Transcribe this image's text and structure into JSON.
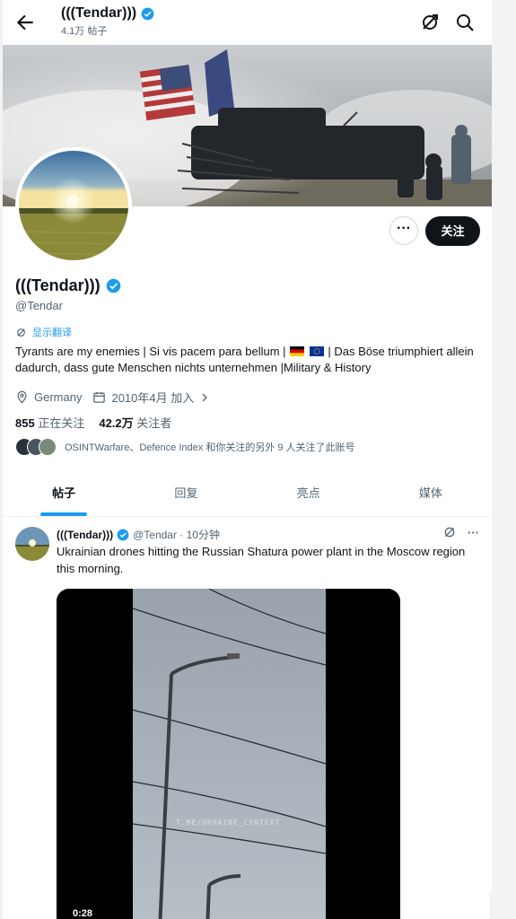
{
  "header": {
    "display_name": "(((Tendar)))",
    "post_count": "4.1万 帖子"
  },
  "profile": {
    "display_name": "(((Tendar)))",
    "handle": "@Tendar",
    "translate_label": "显示翻译",
    "bio_part1": "Tyrants are my enemies | Si vis pacem para bellum |",
    "bio_part2": "| Das Böse triumphiert allein dadurch, dass gute Menschen nichts unternehmen |Military & History",
    "location": "Germany",
    "joined": "2010年4月 加入",
    "following_count": "855",
    "following_label": "正在关注",
    "followers_count": "42.2万",
    "followers_label": "关注者",
    "known_followers_text": "OSINTWarfare、Defence Index 和你关注的另外 9 人关注了此账号",
    "more_button": "···",
    "follow_button": "关注"
  },
  "tabs": [
    "帖子",
    "回复",
    "亮点",
    "媒体"
  ],
  "tweet": {
    "display_name": "(((Tendar)))",
    "handle_time": "@Tendar · 10分钟",
    "text": "Ukrainian drones hitting the Russian Shatura power plant in the Moscow region this morning.",
    "video_watermark": "T.ME/UKRAINE_CONTEXT",
    "video_duration": "0:28",
    "more": "···"
  },
  "colors": {
    "accent": "#1d9bf0",
    "text": "#0f1419",
    "muted": "#536471"
  }
}
